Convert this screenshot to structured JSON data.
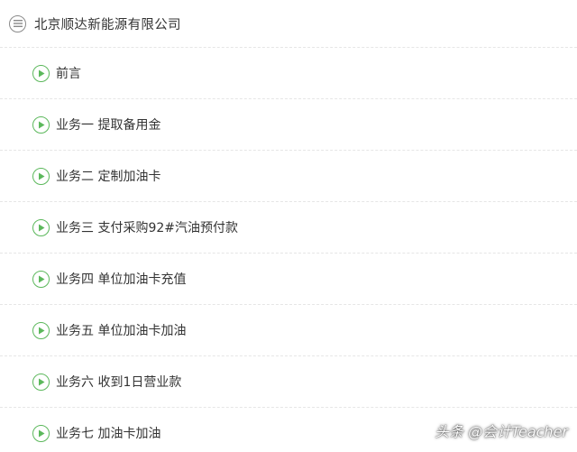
{
  "header": {
    "icon": "list-circle-icon",
    "title": "北京顺达新能源有限公司"
  },
  "items": [
    {
      "icon": "play-circle-icon",
      "label": "前言"
    },
    {
      "icon": "play-circle-icon",
      "label": "业务一 提取备用金"
    },
    {
      "icon": "play-circle-icon",
      "label": "业务二 定制加油卡"
    },
    {
      "icon": "play-circle-icon",
      "label": "业务三 支付采购92#汽油预付款"
    },
    {
      "icon": "play-circle-icon",
      "label": "业务四 单位加油卡充值"
    },
    {
      "icon": "play-circle-icon",
      "label": "业务五 单位加油卡加油"
    },
    {
      "icon": "play-circle-icon",
      "label": "业务六 收到1日营业款"
    },
    {
      "icon": "play-circle-icon",
      "label": "业务七 加油卡加油"
    }
  ],
  "colors": {
    "accent": "#5cb85c",
    "text": "#333333",
    "muted_icon": "#8a8a8a",
    "divider": "#e6e6e6"
  },
  "watermark": "头条 @会计Teacher"
}
